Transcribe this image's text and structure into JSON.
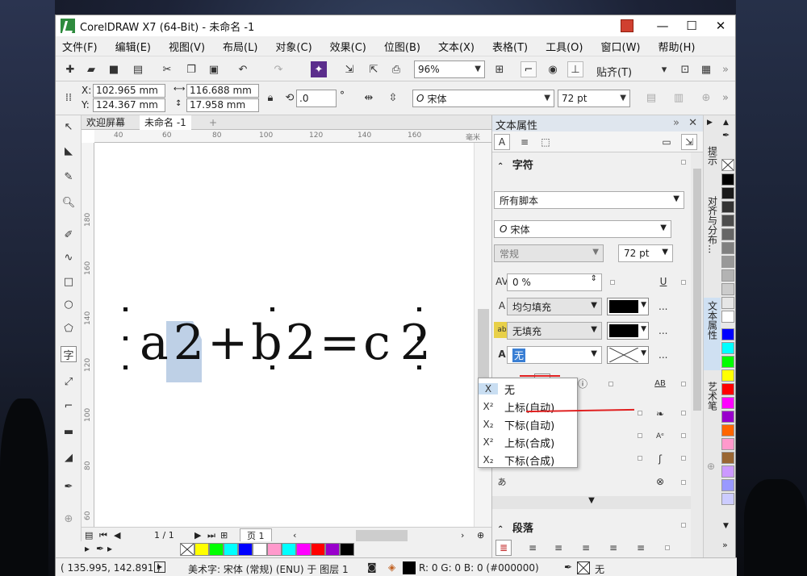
{
  "window": {
    "title": "CorelDRAW X7 (64-Bit) - 未命名 -1",
    "minimize": "—",
    "maximize": "☐",
    "close": "✕"
  },
  "menu": [
    "文件(F)",
    "编辑(E)",
    "视图(V)",
    "布局(L)",
    "对象(C)",
    "效果(C)",
    "位图(B)",
    "文本(X)",
    "表格(T)",
    "工具(O)",
    "窗口(W)",
    "帮助(H)"
  ],
  "toolbar": {
    "zoom": "96%",
    "align_label": "贴齐(T)"
  },
  "propbar": {
    "x_label": "X:",
    "x_value": "102.965 mm",
    "y_label": "Y:",
    "y_value": "124.367 mm",
    "width_value": "116.688 mm",
    "height_value": "17.958 mm",
    "rotation_value": ".0",
    "degree": "°",
    "font_name": "宋体",
    "font_size": "72 pt"
  },
  "tabs": {
    "welcome": "欢迎屏幕",
    "document": "未命名 -1",
    "add": "+"
  },
  "ruler": {
    "h_ticks": [
      "40",
      "60",
      "80",
      "100",
      "120",
      "140",
      "160"
    ],
    "h_unit": "毫米",
    "v_ticks": [
      "180",
      "160",
      "140",
      "120",
      "100",
      "80",
      "60"
    ]
  },
  "canvas": {
    "formula_parts": [
      "a",
      "2",
      "+",
      "b",
      "2",
      "=",
      "c",
      "2"
    ]
  },
  "pagenav": {
    "page_count": "1 / 1",
    "page_tab": "页 1"
  },
  "palette_colors": [
    "#ffff00",
    "#00ff00",
    "#00ffff",
    "#0000ff",
    "#ffffff",
    "#ff99cc",
    "#00ffff",
    "#ff00ff",
    "#ff0000",
    "#9900cc",
    "#000000"
  ],
  "status": {
    "coords": "( 135.995, 142.891 )",
    "object_info": "美术字: 宋体 (常规) (ENU) 于 图层 1",
    "fill_info": "R: 0 G: 0 B: 0 (#000000)",
    "outline_none": "无"
  },
  "docker": {
    "title": "文本属性",
    "character_section": "字符",
    "script": "所有脚本",
    "font": "宋体",
    "style": "常规",
    "size": "72 pt",
    "kerning": "0 %",
    "fill_type": "均匀填充",
    "bg_fill": "无填充",
    "outline": "无",
    "paragraph_section": "段落",
    "more": "...",
    "fill_color": "#000000"
  },
  "dropdown": {
    "items": [
      {
        "icon": "X",
        "label": "无"
      },
      {
        "icon": "X²",
        "label": "上标(自动)"
      },
      {
        "icon": "X₂",
        "label": "下标(自动)"
      },
      {
        "icon": "X²",
        "label": "上标(合成)"
      },
      {
        "icon": "X₂",
        "label": "下标(合成)"
      }
    ]
  },
  "side_tabs": [
    "提示",
    "对齐与分布...",
    "文本属性",
    "艺术笔"
  ],
  "color_palette": [
    "#000000",
    "#1a1a1a",
    "#333333",
    "#4d4d4d",
    "#666666",
    "#808080",
    "#999999",
    "#b3b3b3",
    "#cccccc",
    "#e6e6e6",
    "#ffffff",
    "#0000ff",
    "#00ffff",
    "#00ff00",
    "#ffff00",
    "#ff0000",
    "#ff00ff",
    "#9900cc",
    "#ff6600",
    "#ff99cc",
    "#996633",
    "#cc99ff",
    "#9999ff",
    "#ccccff"
  ]
}
